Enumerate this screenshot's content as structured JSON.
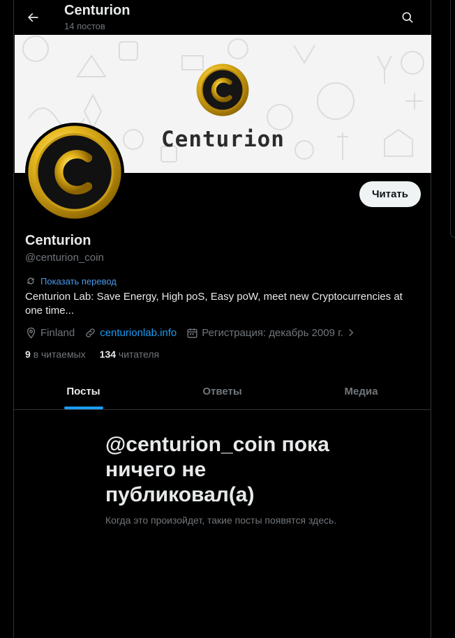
{
  "header": {
    "title": "Centurion",
    "posts_count": "14 постов"
  },
  "banner": {
    "name": "Centurion"
  },
  "profile": {
    "display_name": "Centurion",
    "handle": "@centurion_coin",
    "translate_label": "Показать перевод",
    "bio": "Centurion Lab: Save Energy, High poS, Easy poW, meet new Cryptocurrencies at one time...",
    "follow_label": "Читать",
    "location": "Finland",
    "website": "centurionlab.info",
    "joined": "Регистрация: декабрь 2009 г.",
    "following_count": "9",
    "following_label": "в читаемых",
    "followers_count": "134",
    "followers_label": "читателя"
  },
  "tabs": [
    {
      "label": "Посты",
      "active": true
    },
    {
      "label": "Ответы",
      "active": false
    },
    {
      "label": "Медиа",
      "active": false
    }
  ],
  "empty_state": {
    "title": "@centurion_coin пока ничего не публиковал(а)",
    "subtitle": "Когда это произойдет, такие посты появятся здесь."
  },
  "colors": {
    "accent": "#1d9bf0",
    "coin_gold": "#d4a514"
  }
}
